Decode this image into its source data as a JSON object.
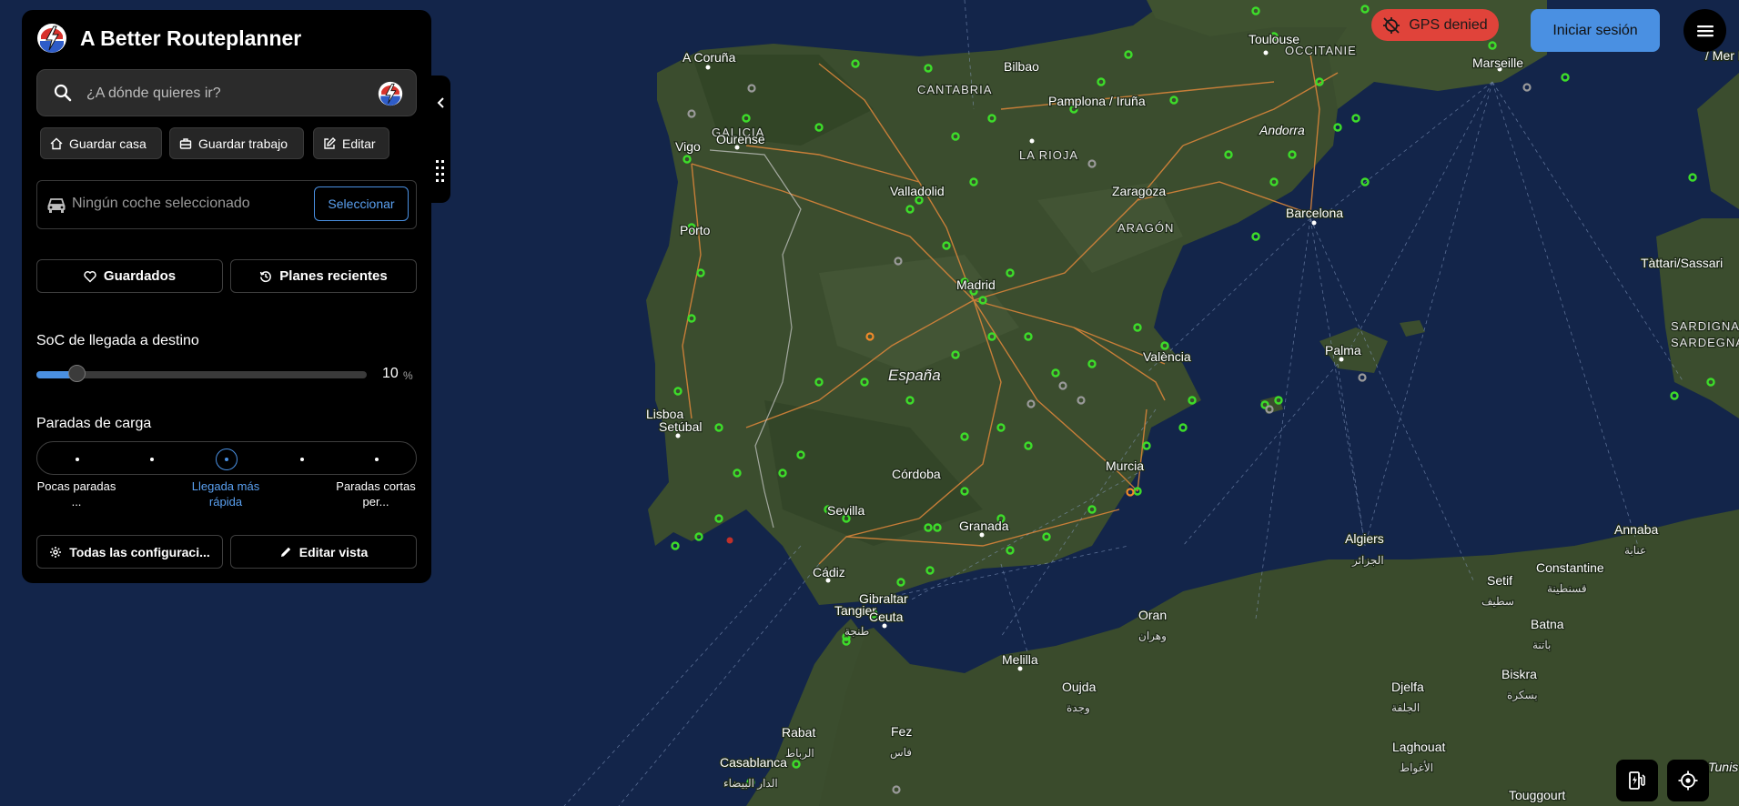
{
  "app": {
    "title": "A Better Routeplanner"
  },
  "search": {
    "placeholder": "¿A dónde quieres ir?"
  },
  "quick_actions": [
    {
      "label": "Guardar casa",
      "icon": "home-icon"
    },
    {
      "label": "Guardar trabajo",
      "icon": "briefcase-icon"
    },
    {
      "label": "Editar",
      "icon": "edit-icon"
    }
  ],
  "car": {
    "placeholder": "Ningún coche seleccionado",
    "select_label": "Seleccionar",
    "icon": "car-icon"
  },
  "saved": {
    "label": "Guardados",
    "icon": "heart-icon"
  },
  "recent": {
    "label": "Planes recientes",
    "icon": "history-icon"
  },
  "soc": {
    "label": "SoC de llegada a destino",
    "value": "10",
    "unit": "%",
    "fraction": 0.12
  },
  "charging": {
    "label": "Paradas de carga",
    "selected_index": 2,
    "options": [
      {
        "label": "Pocas paradas ..."
      },
      {
        "label": ""
      },
      {
        "label": "Llegada más rápida"
      },
      {
        "label": ""
      },
      {
        "label": "Paradas cortas per..."
      }
    ]
  },
  "settings": {
    "label": "Todas las configuraci...",
    "icon": "gear-icon"
  },
  "edit_view": {
    "label": "Editar vista",
    "icon": "pencil-icon"
  },
  "top_right": {
    "gps": "GPS denied",
    "login": "Iniciar sesión"
  },
  "map": {
    "labels": {
      "a_coruna": "A Coruña",
      "bilbao": "Bilbao",
      "cantabria": "CANTABRIA",
      "galicia": "GALICIA",
      "ourense": "Ourense",
      "vigo": "Vigo",
      "pamplona": "Pamplona / Iruña",
      "la_rioja": "LA RIOJA",
      "valladolid": "Valladolid",
      "zaragoza": "Zaragoza",
      "aragon": "ARAGÓN",
      "porto": "Porto",
      "madrid": "Madrid",
      "espana": "España",
      "toulouse": "Toulouse",
      "occitanie": "OCCITANIE",
      "andorra": "Andorra",
      "marseille": "Marseille",
      "mer_ligure": "/ Mer Ligure",
      "barcelona": "Barcelona",
      "tattari": "Tàttari/Sassari",
      "sardigna": "SARDIGNA",
      "sardegna": "SARDEGNA",
      "valencia": "València",
      "palma": "Palma",
      "lisboa": "Lisboa",
      "setubal": "Setúbal",
      "cordoba": "Córdoba",
      "murcia": "Murcia",
      "sevilla": "Sevilla",
      "granada": "Granada",
      "cadiz": "Cádiz",
      "gibraltar": "Gibraltar",
      "tangier": "Tangier",
      "tangier_ar": "طنجة",
      "ceuta": "Ceuta",
      "algiers": "Algiers",
      "algiers_ar": "الجزائر",
      "annaba": "Annaba",
      "annaba_ar": "عنابة",
      "setif": "Setif",
      "setif_ar": "سطيف",
      "constantine": "Constantine",
      "constantine_ar": "قسنطينة",
      "oran": "Oran",
      "oran_ar": "وهران",
      "batna": "Batna",
      "batna_ar": "باتنة",
      "melilla": "Melilla",
      "oujda": "Oujda",
      "oujda_ar": "وجدة",
      "biskra": "Biskra",
      "biskra_ar": "بسكرة",
      "djelfa": "Djelfa",
      "djelfa_ar": "الجلفة",
      "rabat": "Rabat",
      "rabat_ar": "الرباط",
      "fez": "Fez",
      "fez_ar": "فاس",
      "casablanca": "Casablanca",
      "casablanca_ar": "الدار البيضاء",
      "laghouat": "Laghouat",
      "laghouat_ar": "الأغواط",
      "touggourt": "Touggourt",
      "tunis": "Tunis"
    }
  },
  "colors": {
    "accent": "#4a90e2",
    "gps_bg": "#e0433a",
    "panel_bg": "#000000",
    "sea": "#13254a",
    "land": "#3b4d2e",
    "charger": "#3ddc2a",
    "road": "#d7843a"
  }
}
